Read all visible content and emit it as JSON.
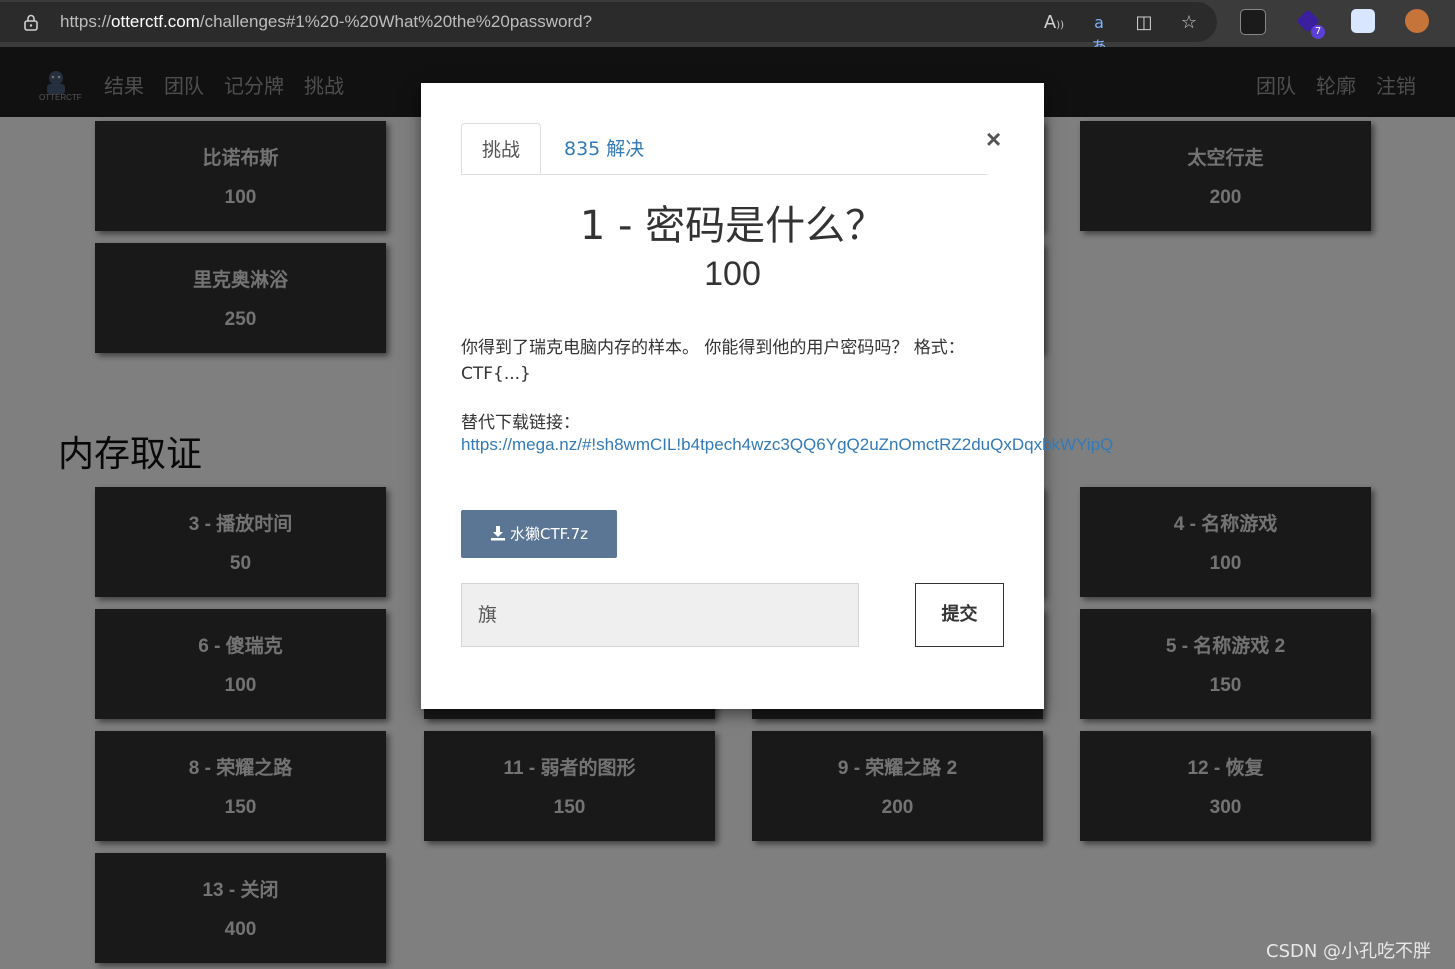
{
  "browser": {
    "url_prefix": "https://",
    "url_host": "otterctf.com",
    "url_path": "/challenges#1%20-%20What%20the%20password?",
    "extension_badge": "7"
  },
  "site": {
    "logo_text": "OTTERCTF",
    "nav_left": [
      "结果",
      "团队",
      "记分牌",
      "挑战"
    ],
    "nav_right": [
      "团队",
      "轮廓",
      "注销"
    ]
  },
  "tiles": [
    {
      "name": "比诺布斯",
      "value": "100"
    },
    {
      "name": "里克奥淋浴",
      "value": "250"
    },
    {
      "name": "太空行走",
      "value": "200"
    },
    {
      "name": "3 - 播放时间",
      "value": "50"
    },
    {
      "name": "4 - 名称游戏",
      "value": "100"
    },
    {
      "name": "6 - 傻瑞克",
      "value": "100"
    },
    {
      "name": "5 - 名称游戏 2",
      "value": "150"
    },
    {
      "name": "8 - 荣耀之路",
      "value": "150"
    },
    {
      "name": "11 - 弱者的图形",
      "value": "150"
    },
    {
      "name": "9 - 荣耀之路 2",
      "value": "200"
    },
    {
      "name": "12 - 恢复",
      "value": "300"
    },
    {
      "name": "13 - 关闭",
      "value": "400"
    }
  ],
  "section_title": "内存取证",
  "modal": {
    "tab_challenge": "挑战",
    "tab_solves": "835 解决",
    "close": "×",
    "title": "1 - 密码是什么？",
    "value": "100",
    "description": "你得到了瑞克电脑内存的样本。 你能得到他的用户密码吗？ 格式：CTF{...}",
    "alt_label": "替代下载链接：",
    "alt_link": "https://mega.nz/#!sh8wmCIL!b4tpech4wzc3QQ6YgQ2uZnOmctRZ2duQxDqxbkWYipQ",
    "download_label": "水獭CTF.7z",
    "flag_placeholder": "旗",
    "submit_label": "提交"
  },
  "watermark": "CSDN @小孔吃不胖"
}
